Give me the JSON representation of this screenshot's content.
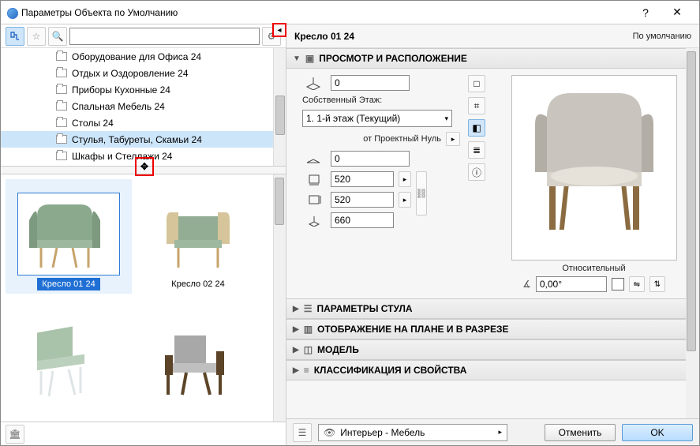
{
  "titlebar": {
    "title": "Параметры Объекта по Умолчанию",
    "help": "?",
    "close": "✕"
  },
  "toolbar": {
    "search_placeholder": ""
  },
  "tree": {
    "items": [
      "Оборудование для Офиса 24",
      "Отдых и Оздоровление 24",
      "Приборы Кухонные 24",
      "Спальная Мебель 24",
      "Столы 24",
      "Стулья, Табуреты, Скамьи 24",
      "Шкафы и Стеллажи 24"
    ],
    "selected_index": 5
  },
  "grid": {
    "items": [
      "Кресло 01 24",
      "Кресло 02 24",
      "",
      ""
    ],
    "selected_index": 0
  },
  "right": {
    "title": "Кресло 01 24",
    "default_label": "По умолчанию",
    "sections": {
      "view": "ПРОСМОТР И РАСПОЛОЖЕНИЕ",
      "params": "ПАРАМЕТРЫ СТУЛА",
      "plan": "ОТОБРАЖЕНИЕ НА ПЛАНЕ И В РАЗРЕЗЕ",
      "model": "МОДЕЛЬ",
      "class": "КЛАССИФИКАЦИЯ И СВОЙСТВА"
    },
    "form": {
      "origin_z": "0",
      "own_story_label": "Собственный Этаж:",
      "story_value": "1. 1-й этаж (Текущий)",
      "from_project_zero": "от Проектный Нуль",
      "project_zero_value": "0",
      "width": "520",
      "depth": "520",
      "height": "660"
    },
    "relative": {
      "label": "Относительный",
      "angle": "0,00°"
    }
  },
  "footer": {
    "layer": "Интерьер - Мебель",
    "cancel": "Отменить",
    "ok": "OK"
  }
}
